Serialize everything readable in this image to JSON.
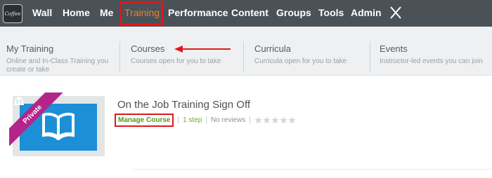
{
  "logo": {
    "text": "Coffee"
  },
  "nav": {
    "items": [
      {
        "label": "Wall"
      },
      {
        "label": "Home"
      },
      {
        "label": "Me"
      },
      {
        "label": "Training"
      },
      {
        "label": "Performance"
      },
      {
        "label": "Content"
      },
      {
        "label": "Groups"
      },
      {
        "label": "Tools"
      },
      {
        "label": "Admin"
      }
    ],
    "active_color": "#f57c22"
  },
  "menu": {
    "columns": [
      {
        "title": "My Training",
        "desc": "Online and In-Class Training you create or take"
      },
      {
        "title": "Courses",
        "desc": "Courses open for you to take"
      },
      {
        "title": "Curricula",
        "desc": "Curricula open for you to take"
      },
      {
        "title": "Events",
        "desc": "Instructor-led events you can join"
      }
    ]
  },
  "course": {
    "badge": "Private",
    "title": "On the Job Training Sign Off",
    "manage_label": "Manage Course",
    "steps": "1 step",
    "reviews": "No reviews",
    "rating": 0,
    "max_rating": 5
  },
  "colors": {
    "topbar": "#4a5258",
    "highlight": "#e0181b",
    "thumbnail": "#1c8fd6",
    "ribbon": "#b4258a",
    "link_green": "#4f9b1c"
  }
}
